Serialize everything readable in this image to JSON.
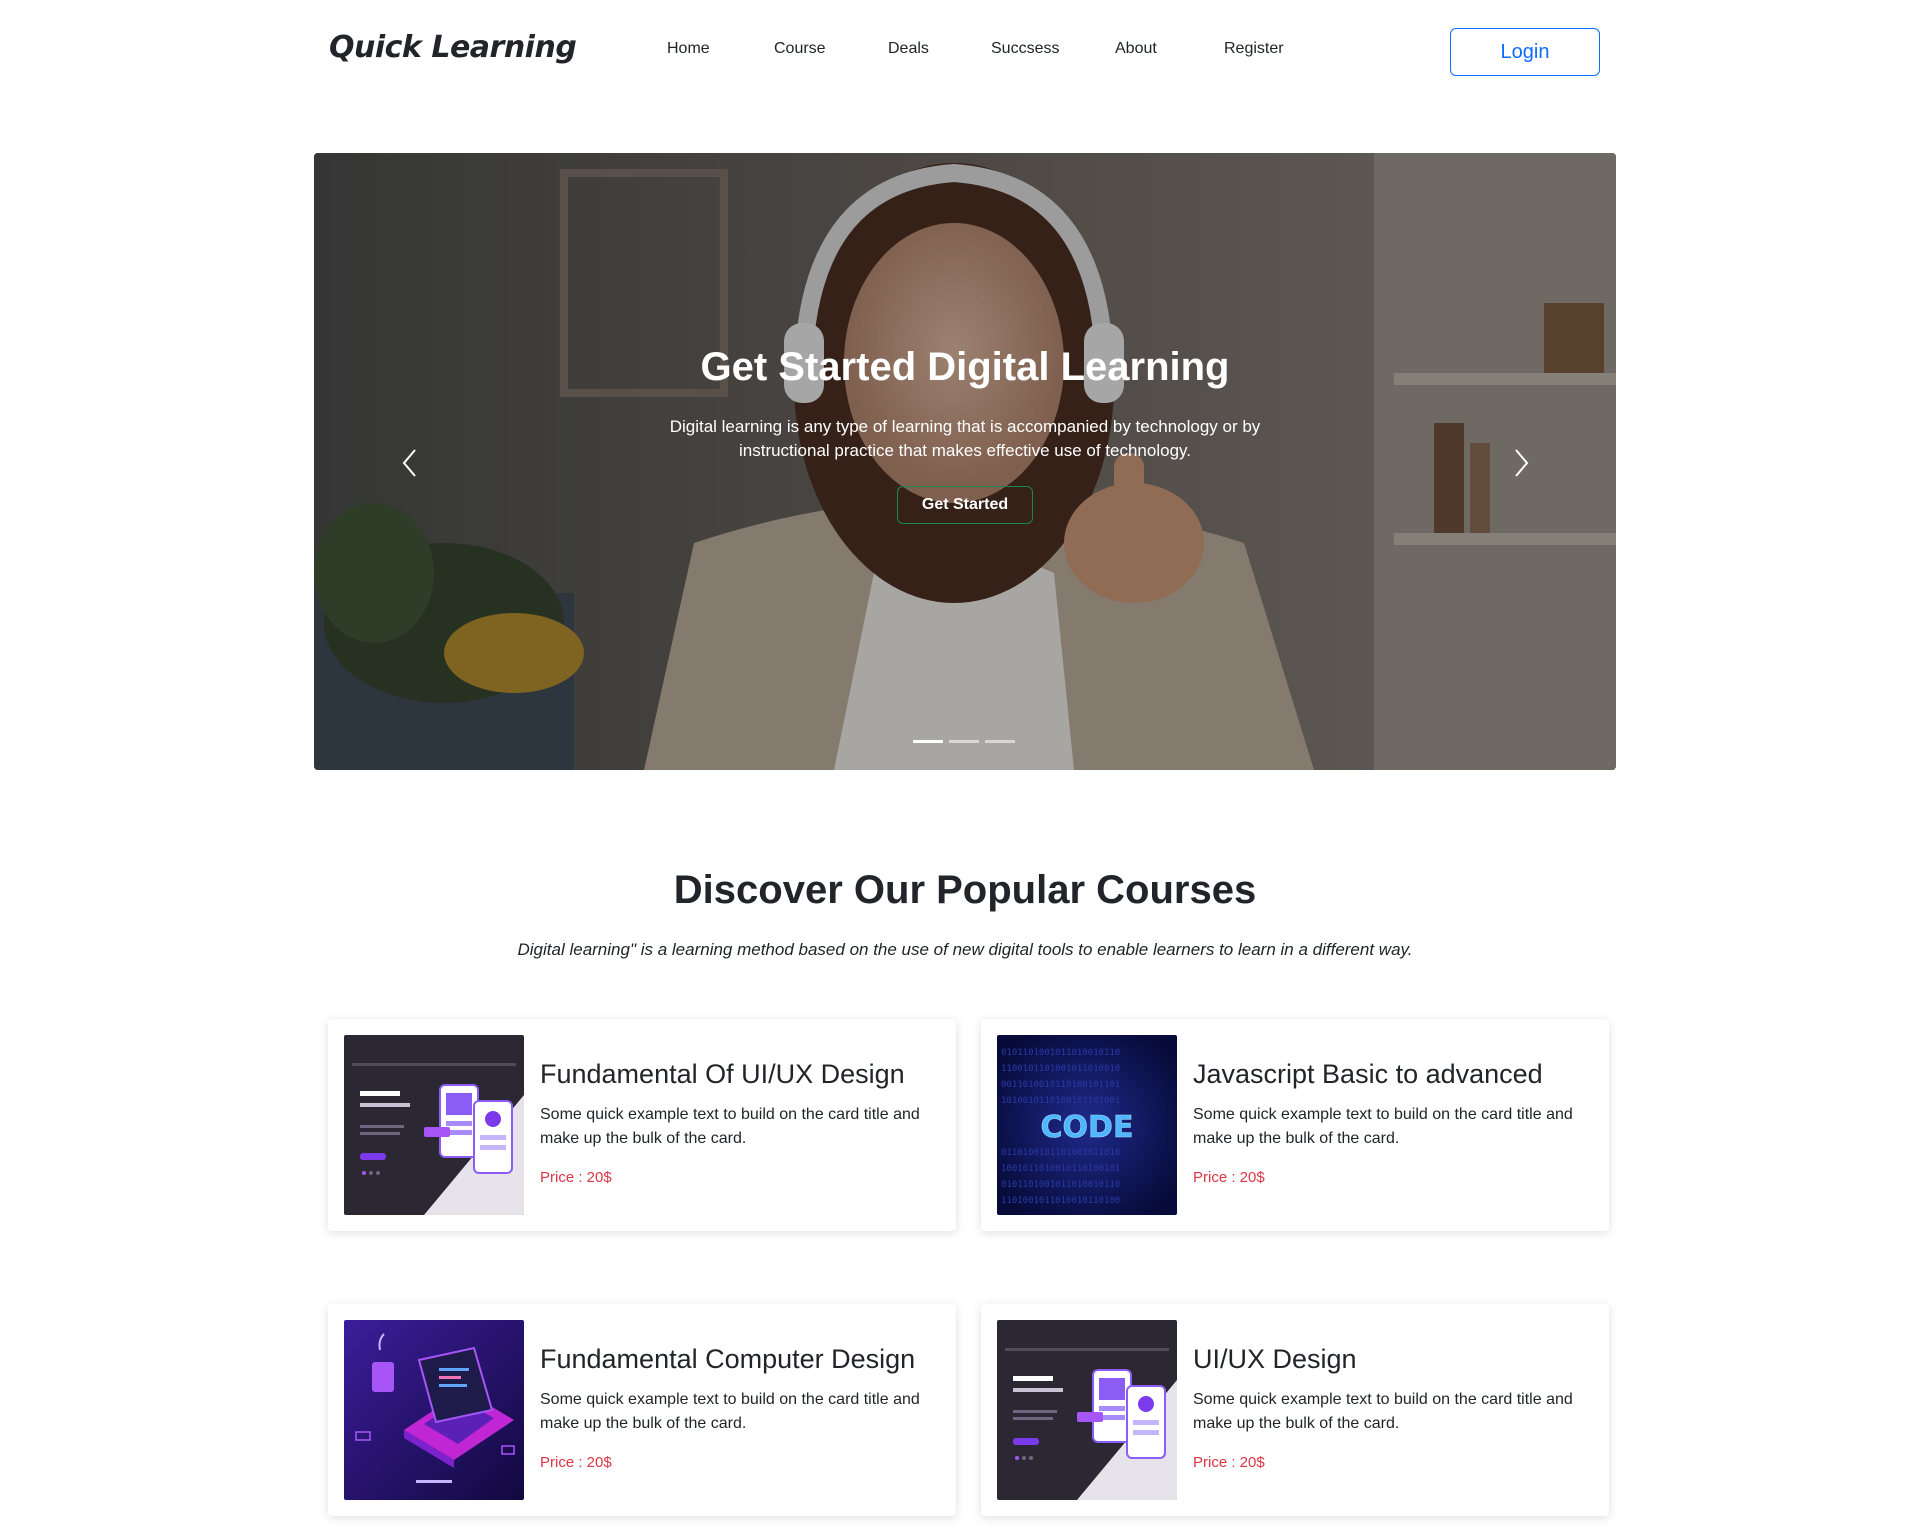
{
  "navbar": {
    "brand": "Quick Learning",
    "links": [
      "Home",
      "Course",
      "Deals",
      "Succsess",
      "About",
      "Register"
    ],
    "login_label": "Login"
  },
  "hero": {
    "title": "Get Started Digital Learning",
    "text": "Digital learning is any type of learning that is accompanied by technology or by instructional practice that makes effective use of technology.",
    "button_label": "Get Started",
    "active_slide": 1,
    "slide_count": 3
  },
  "courses": {
    "title": "Discover Our Popular Courses",
    "subtitle": "Digital learning\" is a learning method based on the use of new digital tools to enable learners to learn in a different way.",
    "cards": [
      {
        "title": "Fundamental Of UI/UX Design",
        "text": "Some quick example text to build on the card title and make up the bulk of the card.",
        "price": "Price : 20$"
      },
      {
        "title": "Javascript Basic to advanced",
        "text": "Some quick example text to build on the card title and make up the bulk of the card.",
        "price": "Price : 20$",
        "image_text": "CODE"
      },
      {
        "title": "Fundamental Computer Design",
        "text": "Some quick example text to build on the card title and make up the bulk of the card.",
        "price": "Price : 20$"
      },
      {
        "title": "UI/UX Design",
        "text": "Some quick example text to build on the card title and make up the bulk of the card.",
        "price": "Price : 20$"
      }
    ]
  },
  "colors": {
    "primary": "#0d6efd",
    "price": "#dc3545",
    "hero_button_border": "#198754"
  }
}
